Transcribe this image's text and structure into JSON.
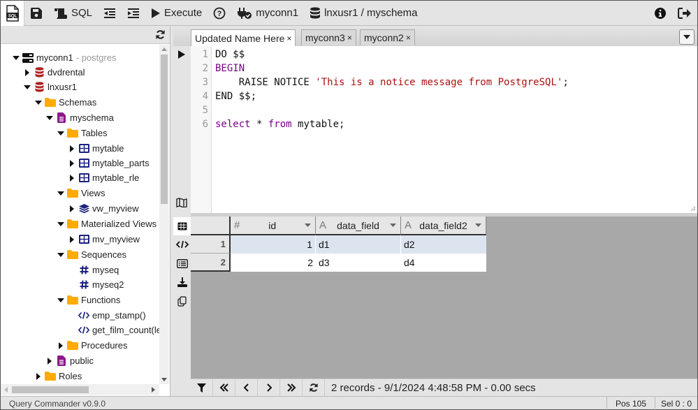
{
  "toolbar": {
    "sql_label": "SQL",
    "execute_label": "Execute",
    "connection_label": "myconn1",
    "database_label": "lnxusr1 / myschema"
  },
  "tree": [
    {
      "label": "myconn1",
      "sub": "- postgres",
      "icon": "server-icon",
      "state": "open",
      "depth": 0
    },
    {
      "label": "dvdrental",
      "icon": "database-icon",
      "state": "closed",
      "depth": 1
    },
    {
      "label": "lnxusr1",
      "icon": "database-icon",
      "state": "open",
      "depth": 1
    },
    {
      "label": "Schemas",
      "icon": "folder-icon",
      "state": "open",
      "depth": 2
    },
    {
      "label": "myschema",
      "icon": "schema-icon",
      "state": "open",
      "depth": 3
    },
    {
      "label": "Tables",
      "icon": "folder-icon",
      "state": "open",
      "depth": 4
    },
    {
      "label": "mytable",
      "icon": "table-icon",
      "state": "closed",
      "depth": 5
    },
    {
      "label": "mytable_parts",
      "icon": "table-icon",
      "state": "closed",
      "depth": 5
    },
    {
      "label": "mytable_rle",
      "icon": "table-icon",
      "state": "closed",
      "depth": 5
    },
    {
      "label": "Views",
      "icon": "folder-icon",
      "state": "open",
      "depth": 4
    },
    {
      "label": "vw_myview",
      "icon": "layers-icon",
      "state": "closed",
      "depth": 5
    },
    {
      "label": "Materialized Views",
      "icon": "folder-icon",
      "state": "open",
      "depth": 4
    },
    {
      "label": "mv_myview",
      "icon": "table-icon",
      "state": "closed",
      "depth": 5
    },
    {
      "label": "Sequences",
      "icon": "folder-icon",
      "state": "open",
      "depth": 4
    },
    {
      "label": "myseq",
      "icon": "hash-icon",
      "state": "leaf",
      "depth": 5
    },
    {
      "label": "myseq2",
      "icon": "hash-icon",
      "state": "leaf",
      "depth": 5
    },
    {
      "label": "Functions",
      "icon": "folder-icon",
      "state": "open",
      "depth": 4
    },
    {
      "label": "emp_stamp()",
      "icon": "code-icon",
      "state": "leaf",
      "depth": 5
    },
    {
      "label": "get_film_count(le",
      "icon": "code-icon",
      "state": "leaf",
      "depth": 5
    },
    {
      "label": "Procedures",
      "icon": "folder-icon",
      "state": "closed",
      "depth": 4
    },
    {
      "label": "public",
      "icon": "schema-icon",
      "state": "closed",
      "depth": 3
    },
    {
      "label": "Roles",
      "icon": "folder-icon",
      "state": "closed",
      "depth": 2
    }
  ],
  "tabs": [
    {
      "label": "Updated Name Here",
      "close": "×",
      "active": true
    },
    {
      "label": "myconn3",
      "close": "×",
      "active": false
    },
    {
      "label": "myconn2",
      "close": "×",
      "active": false
    }
  ],
  "editor": {
    "lines": [
      {
        "no": "1",
        "tokens": [
          {
            "t": "DO $$",
            "c": ""
          }
        ]
      },
      {
        "no": "2",
        "tokens": [
          {
            "t": "BEGIN",
            "c": "kw"
          }
        ]
      },
      {
        "no": "3",
        "tokens": [
          {
            "t": "    RAISE NOTICE ",
            "c": ""
          },
          {
            "t": "'This is a notice message from PostgreSQL'",
            "c": "str"
          },
          {
            "t": ";",
            "c": ""
          }
        ]
      },
      {
        "no": "4",
        "tokens": [
          {
            "t": "END $$;",
            "c": ""
          }
        ]
      },
      {
        "no": "5",
        "tokens": []
      },
      {
        "no": "6",
        "tokens": [
          {
            "t": "select",
            "c": "kw"
          },
          {
            "t": " * ",
            "c": ""
          },
          {
            "t": "from",
            "c": "kw"
          },
          {
            "t": " mytable;",
            "c": ""
          }
        ]
      }
    ]
  },
  "results": {
    "columns": [
      {
        "type": "#",
        "name": "id",
        "numeric": true
      },
      {
        "type": "A",
        "name": "data_field",
        "numeric": false
      },
      {
        "type": "A",
        "name": "data_field2",
        "numeric": false
      }
    ],
    "rows": [
      {
        "n": "1",
        "cells": [
          "1",
          "d1",
          "d2"
        ],
        "selected": true
      },
      {
        "n": "2",
        "cells": [
          "2",
          "d3",
          "d4"
        ],
        "selected": false
      }
    ],
    "status": "2 records - 9/1/2024 4:48:58 PM - 0.00 secs",
    "selected_row_color": "#dce4ef"
  },
  "statusbar": {
    "version": "Query Commander v0.9.0",
    "pos": "Pos 105",
    "sel": "Sel 0 : 0"
  },
  "colors": {
    "database": "#b22222",
    "folder": "#ffab00",
    "schema": "#8b1a8b",
    "table": "#1a237e",
    "keyword": "#770088",
    "string": "#aa1111"
  }
}
